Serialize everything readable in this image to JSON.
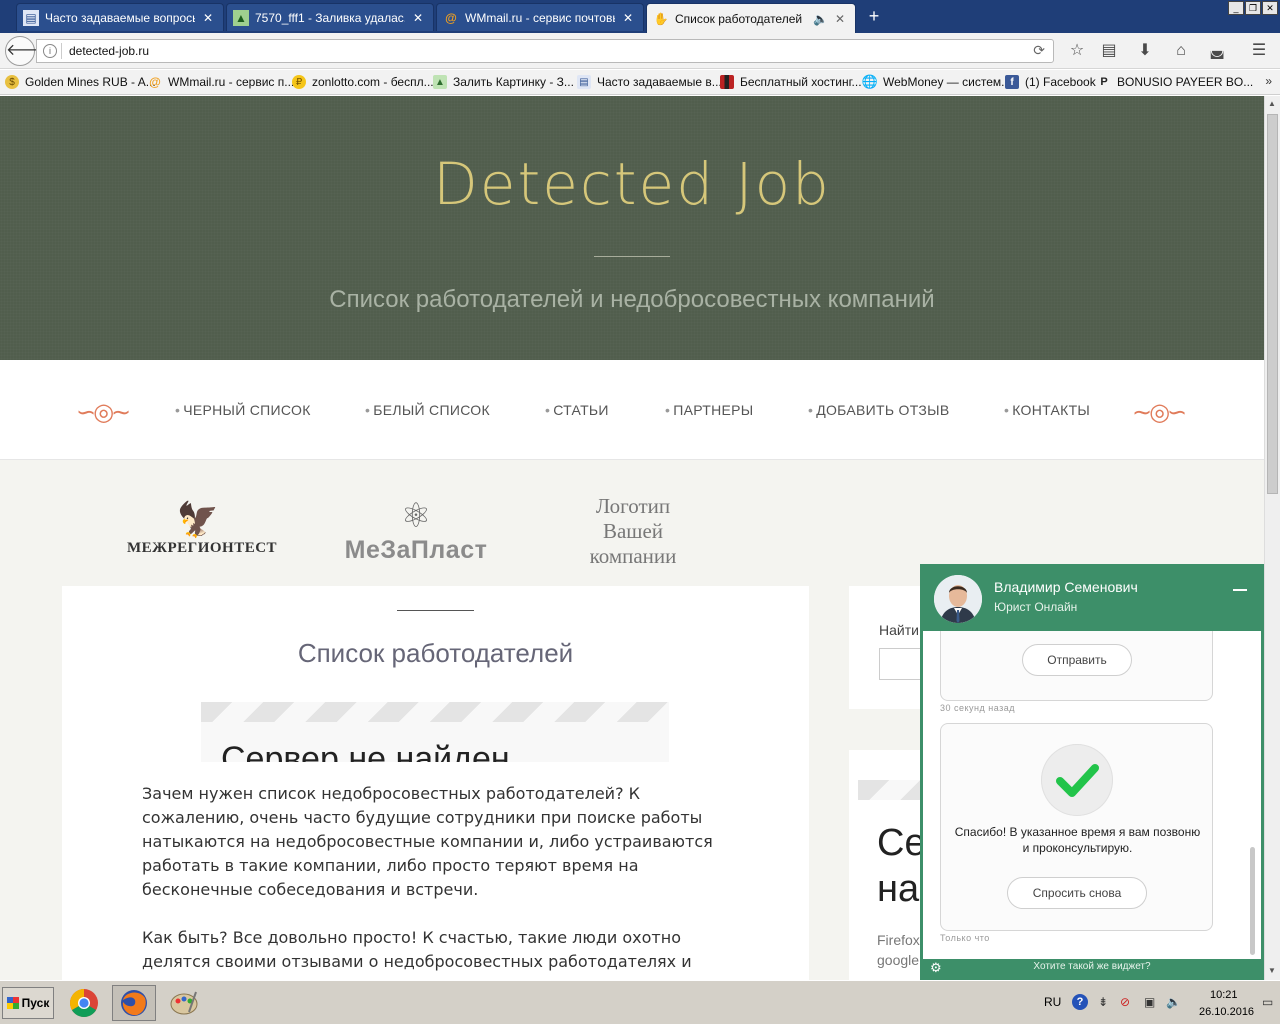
{
  "browser": {
    "tabs": [
      {
        "label": "Часто задаваемые вопросы...",
        "icon": "document-icon"
      },
      {
        "label": "7570_fff1 - Заливка удалас...",
        "icon": "image-icon"
      },
      {
        "label": "WMmail.ru - сервис почтовы...",
        "icon": "at-icon"
      },
      {
        "label": "Список работодателей",
        "icon": "hand-icon"
      }
    ],
    "url": "detected-job.ru",
    "bookmarks": [
      {
        "label": "Golden Mines RUB - A..."
      },
      {
        "label": "WMmail.ru - сервис п..."
      },
      {
        "label": "zonlotto.com - беспл..."
      },
      {
        "label": "Залить Картинку - З..."
      },
      {
        "label": "Часто задаваемые в..."
      },
      {
        "label": "Бесплатный хостинг..."
      },
      {
        "label": "WebMoney — систем..."
      },
      {
        "label": "(1) Facebook"
      },
      {
        "label": "BONUSIO PAYEER BO..."
      }
    ]
  },
  "site": {
    "title": "Detected Job",
    "tagline": "Список работодателей и недобросовестных компаний",
    "menu": [
      "ЧЕРНЫЙ СПИСОК",
      "БЕЛЫЙ СПИСОК",
      "СТАТЬИ",
      "ПАРТНЕРЫ",
      "ДОБАВИТЬ ОТЗЫВ",
      "КОНТАКТЫ"
    ],
    "partners": {
      "logo1": "МЕЖРЕГИОНТЕСТ",
      "logo2": "МеЗаПласт",
      "logo3_line1": "Логотип",
      "logo3_line2": "Вашей",
      "logo3_line3": "компании"
    },
    "content": {
      "title": "Список работодателей",
      "iframe_heading": "Сервер не найден",
      "paragraph1": "Зачем нужен список недобросовестных работодателей? К сожалению, очень часто будущие сотрудники при поиске работы натыкаются на недобросовестные компании и, либо устраиваются работать в такие компании, либо просто теряют время на бесконечные собеседования и встречи.",
      "paragraph2": "Как быть? Все довольно просто! К счастью, такие люди охотно делятся своими отзывами о недобросовестных работодателях и предостерегают"
    },
    "sidebar": {
      "search_label": "Найти",
      "heading_line1": "Се",
      "heading_line2": "на",
      "text_line1": "Firefox",
      "text_line2": "google"
    }
  },
  "chat": {
    "agent_name": "Владимир Семенович",
    "agent_role": "Юрист Онлайн",
    "send_button": "Отправить",
    "timestamp1": "30 секунд назад",
    "thanks_message": "Спасибо! В указанное время я вам позвоню и проконсультирую.",
    "ask_again_button": "Спросить снова",
    "timestamp2": "Только что",
    "footer_link": "Хотите такой же виджет?"
  },
  "taskbar": {
    "start_label": "Пуск",
    "language": "RU",
    "time": "10:21",
    "date": "26.10.2016"
  },
  "colors": {
    "hero_bg": "#515e4d",
    "title_gold": "#d6c77a",
    "menu_ornament": "#e07b5a",
    "chat_green": "#3d8f69",
    "check_green": "#22c44a"
  }
}
